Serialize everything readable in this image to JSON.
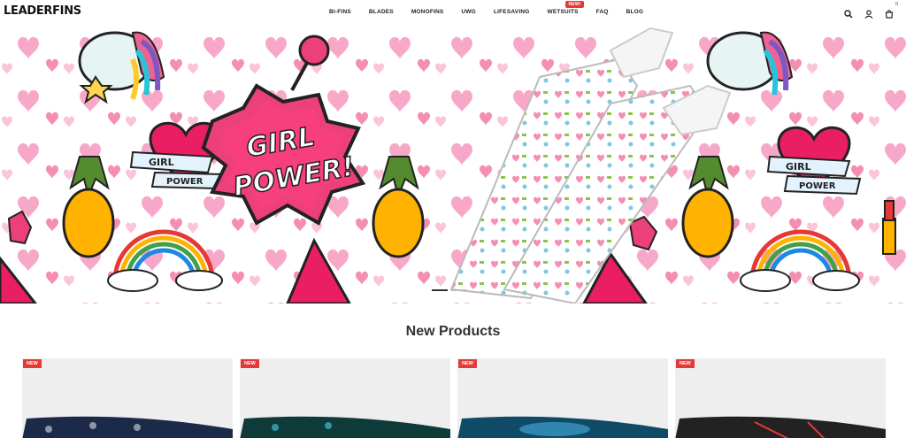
{
  "brand": {
    "logo_text": "LEADERFINS"
  },
  "nav": {
    "items": [
      {
        "label": "BI-FINS"
      },
      {
        "label": "BLADES"
      },
      {
        "label": "MONOFINS"
      },
      {
        "label": "UWG"
      },
      {
        "label": "LIFESAVING"
      },
      {
        "label": "WETSUITS",
        "badge": "NEW!"
      },
      {
        "label": "FAQ"
      },
      {
        "label": "BLOG"
      }
    ]
  },
  "header_icons": {
    "search": "search-icon",
    "account": "user-icon",
    "cart": "cart-icon",
    "cart_count": "0"
  },
  "hero": {
    "headline_line1": "GIRL",
    "headline_line2": "POWER!",
    "ribbon_text_1": "GIRL",
    "ribbon_text_2": "POWER"
  },
  "products_section": {
    "title": "New Products",
    "cards": [
      {
        "badge": "NEW",
        "fin_color": "#1c2a4a"
      },
      {
        "badge": "NEW",
        "fin_color": "#0e3a3a"
      },
      {
        "badge": "NEW",
        "fin_color": "#0f4a66"
      },
      {
        "badge": "NEW",
        "fin_color": "#222222"
      }
    ]
  },
  "colors": {
    "accent": "#e53935",
    "hero_pink": "#f06292",
    "text_dark": "#333333"
  }
}
